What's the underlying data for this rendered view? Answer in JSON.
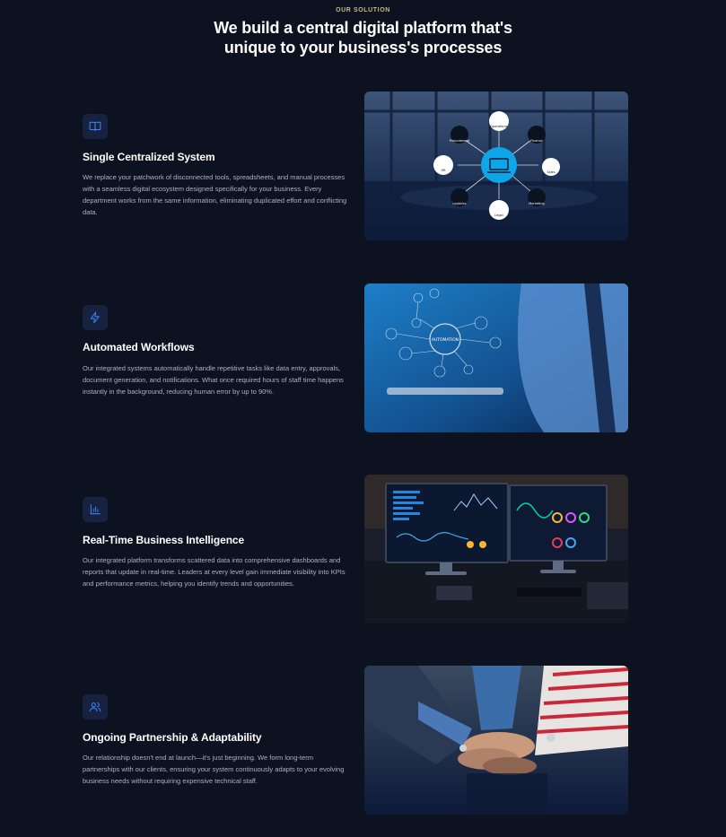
{
  "section": {
    "eyebrow": "OUR SOLUTION",
    "headline_line1": "We build a central digital platform that's",
    "headline_line2": "unique to your business's processes"
  },
  "features": [
    {
      "icon": "book-icon",
      "title": "Single Centralized System",
      "description": "We replace your patchwork of disconnected tools, spreadsheets, and manual processes with a seamless digital ecosystem designed specifically for your business. Every department works from the same information, eliminating duplicated effort and conflicting data.",
      "image_labels": [
        "Operations",
        "Finance",
        "Sales",
        "Marketing",
        "Legal",
        "Logistics",
        "HR",
        "Procurement"
      ]
    },
    {
      "icon": "lightning-icon",
      "title": "Automated Workflows",
      "description": "Our integrated systems automatically handle repetitive tasks like data entry, approvals, document generation, and notifications. What once required hours of staff time happens instantly in the background, reducing human error by up to 90%.",
      "image_label": "AUTOMATION"
    },
    {
      "icon": "bar-chart-icon",
      "title": "Real-Time Business Intelligence",
      "description": "Our integrated platform transforms scattered data into comprehensive dashboards and reports that update in real-time. Leaders at every level gain immediate visibility into KPIs and performance metrics, helping you identify trends and opportunities."
    },
    {
      "icon": "users-icon",
      "title": "Ongoing Partnership & Adaptability",
      "description": "Our relationship doesn't end at launch—it's just beginning. We form long-term partnerships with our clients, ensuring your system continuously adapts to your evolving business needs without requiring expensive technical staff."
    }
  ],
  "colors": {
    "background": "#0d1220",
    "icon_box": "#16223f",
    "icon_stroke": "#3b82f6",
    "accent": "#0ea5e9",
    "body_text": "#a9b2c4"
  }
}
